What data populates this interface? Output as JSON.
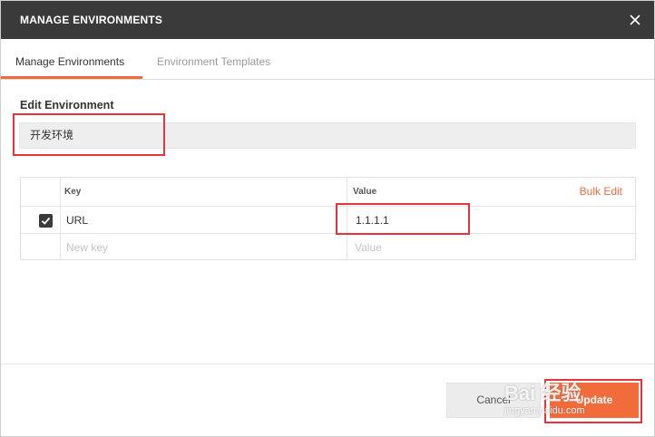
{
  "dialog": {
    "title": "MANAGE ENVIRONMENTS"
  },
  "tabs": [
    {
      "label": "Manage Environments",
      "active": true
    },
    {
      "label": "Environment Templates",
      "active": false
    }
  ],
  "edit": {
    "section_label": "Edit Environment",
    "name_value": "开发环境"
  },
  "table": {
    "key_header": "Key",
    "value_header": "Value",
    "bulk_edit": "Bulk Edit",
    "rows": [
      {
        "checked": true,
        "key": "URL",
        "value": "1.1.1.1"
      }
    ],
    "new_key_placeholder": "New key",
    "new_value_placeholder": "Value"
  },
  "footer": {
    "cancel_label": "Cancel",
    "update_label": "Update"
  },
  "watermark": {
    "brand": "Bai 经验",
    "url": "jingyan.baidu.com"
  },
  "colors": {
    "accent": "#f26b3a",
    "titlebar": "#3a3a3a",
    "highlight": "#e8333a"
  }
}
